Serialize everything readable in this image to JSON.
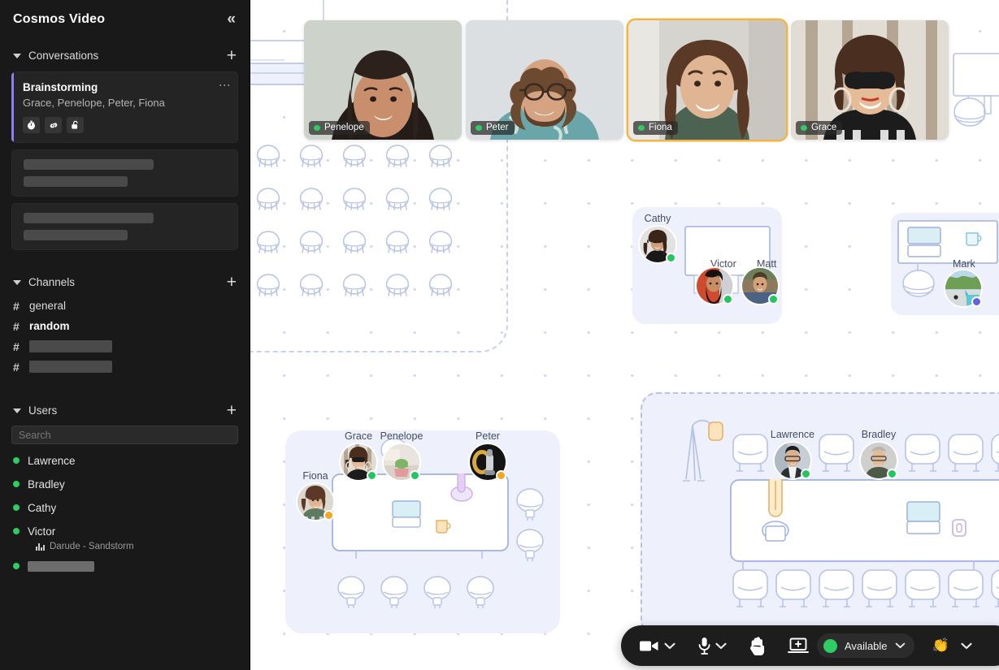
{
  "app": {
    "title": "Cosmos Video",
    "collapse_icon": "chevrons-left-icon"
  },
  "sidebar": {
    "conversations": {
      "label": "Conversations",
      "add_label": "+",
      "items": [
        {
          "name": "Brainstorming",
          "members": "Grace, Penelope, Peter, Fiona",
          "icons": [
            "timer-icon",
            "link-icon",
            "unlock-icon"
          ],
          "active": true
        },
        {
          "name": "",
          "members": "",
          "placeholder": true
        },
        {
          "name": "",
          "members": "",
          "placeholder": true
        }
      ]
    },
    "channels": {
      "label": "Channels",
      "add_label": "+",
      "items": [
        {
          "name": "general",
          "bold": false,
          "placeholder": false
        },
        {
          "name": "random",
          "bold": true,
          "placeholder": false
        },
        {
          "name": "",
          "bold": false,
          "placeholder": true
        },
        {
          "name": "",
          "bold": false,
          "placeholder": true
        }
      ]
    },
    "users": {
      "label": "Users",
      "add_label": "+",
      "search_placeholder": "Search",
      "search_value": "",
      "items": [
        {
          "name": "Lawrence",
          "status": "online",
          "sub": "",
          "placeholder": false
        },
        {
          "name": "Bradley",
          "status": "online",
          "sub": "",
          "placeholder": false
        },
        {
          "name": "Cathy",
          "status": "online",
          "sub": "",
          "placeholder": false
        },
        {
          "name": "Victor",
          "status": "online",
          "sub": "Darude - Sandstorm",
          "placeholder": false
        },
        {
          "name": "",
          "status": "online",
          "sub": "",
          "placeholder": true
        }
      ]
    }
  },
  "video_tiles": [
    {
      "name": "Penelope",
      "status": "online",
      "speaking": false,
      "bg": "#cdd2cb"
    },
    {
      "name": "Peter",
      "status": "online",
      "speaking": false,
      "bg": "#dcdfe2"
    },
    {
      "name": "Fiona",
      "status": "online",
      "speaking": true,
      "bg": "#d5d4cf"
    },
    {
      "name": "Grace",
      "status": "online",
      "speaking": false,
      "bg": "#cdc4b6"
    }
  ],
  "map": {
    "rooms": [
      {
        "id": "stool-room",
        "label": ""
      },
      {
        "id": "cathy-huddle",
        "label": ""
      },
      {
        "id": "mark-desk",
        "label": ""
      },
      {
        "id": "brainstorm-table",
        "label": ""
      },
      {
        "id": "long-table-room",
        "label": ""
      }
    ],
    "people": [
      {
        "name": "Cathy",
        "status": "online",
        "group": "cathy-huddle"
      },
      {
        "name": "Victor",
        "status": "online",
        "group": "cathy-huddle"
      },
      {
        "name": "Matt",
        "status": "online",
        "group": "cathy-huddle"
      },
      {
        "name": "Mark",
        "status": "busy",
        "group": "mark-desk"
      },
      {
        "name": "Grace",
        "status": "online",
        "group": "brainstorm-table"
      },
      {
        "name": "Penelope",
        "status": "online",
        "group": "brainstorm-table"
      },
      {
        "name": "Peter",
        "status": "away",
        "group": "brainstorm-table"
      },
      {
        "name": "Fiona",
        "status": "away",
        "group": "brainstorm-table"
      },
      {
        "name": "Lawrence",
        "status": "online",
        "group": "long-table-room"
      },
      {
        "name": "Bradley",
        "status": "online",
        "group": "long-table-room"
      }
    ]
  },
  "toolbar": {
    "camera_icon": "video-camera-icon",
    "camera_chevron": "chevron-down-icon",
    "mic_icon": "microphone-icon",
    "mic_chevron": "chevron-down-icon",
    "hand_icon": "raised-hand-icon",
    "screen_share_icon": "screen-share-icon",
    "status_label": "Available",
    "status_color": "#2ecc62",
    "status_chevron": "chevron-down-icon",
    "reaction_icon": "clap-hands-icon",
    "reaction_chevron": "chevron-down-icon"
  },
  "colors": {
    "sidebar_bg": "#191919",
    "accent_purple": "#8b7ff0",
    "online_green": "#2ecc62",
    "away_amber": "#f5a623",
    "room_fill": "#eef0fc",
    "furniture_stroke": "#b7c2e8"
  }
}
